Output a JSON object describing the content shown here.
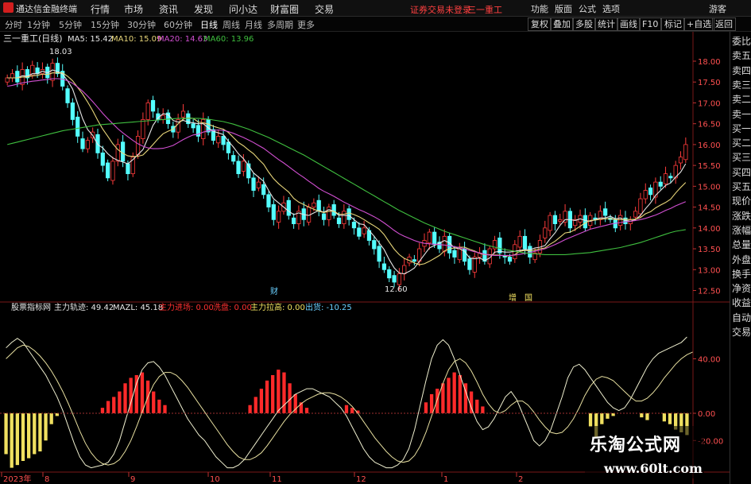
{
  "app": {
    "name": "通达信金融终端",
    "menus": [
      "行情",
      "市场",
      "资讯",
      "发现",
      "问小达",
      "财富圈",
      "交易"
    ],
    "login_notice": "证券交易未登录",
    "stock_short": "三一重工",
    "right_menus": [
      "功能",
      "版面",
      "公式",
      "选项"
    ],
    "guest": "游客"
  },
  "periods": [
    "分时",
    "1分钟",
    "5分钟",
    "15分钟",
    "30分钟",
    "60分钟",
    "日线",
    "周线",
    "月线",
    "多周期",
    "更多"
  ],
  "toolbar_right": [
    "复权",
    "叠加",
    "多股",
    "统计",
    "画线",
    "F10",
    "标记",
    "+自选",
    "返回"
  ],
  "side_panel": [
    "委比",
    "卖五",
    "卖四",
    "卖三",
    "卖二",
    "卖一",
    "买一",
    "买二",
    "买三",
    "买四",
    "买五",
    "现价",
    "涨跌",
    "涨幅",
    "总量",
    "外盘",
    "换手",
    "净资",
    "收益",
    "自动",
    "交易"
  ],
  "main_legend": {
    "title": "三一重工(日线)",
    "items": [
      {
        "label": "MA5: 15.42",
        "color": "#e6e6e6"
      },
      {
        "label": "MA10: 15.09",
        "color": "#e8d67a"
      },
      {
        "label": "MA20: 14.63",
        "color": "#d24fd2"
      },
      {
        "label": "MA60: 13.96",
        "color": "#3fbf3f"
      }
    ]
  },
  "sub_legend": {
    "name": "股票指标网",
    "items": [
      {
        "label": "主力轨迹: 49.42",
        "color": "#e6e6e6"
      },
      {
        "label": "MAZL: 45.18",
        "color": "#e6e6e6"
      },
      {
        "label": "主力进场: 0.00",
        "color": "#ff3030"
      },
      {
        "label": "洗盘: 0.00",
        "color": "#ff3030"
      },
      {
        "label": "主力拉高: 0.00",
        "color": "#f0e060"
      },
      {
        "label": "出货: -10.25",
        "color": "#6ad0ff"
      }
    ]
  },
  "annotations": {
    "high": "18.03",
    "low": "12.60",
    "marker1": "财",
    "marker2": "增",
    "marker3": "国"
  },
  "x_labels": [
    "2023年",
    "8",
    "9",
    "10",
    "11",
    "12",
    "1",
    "2"
  ],
  "colors": {
    "up": "#ff3b3b",
    "down": "#54ffff",
    "ma5": "#e6e6e6",
    "ma10": "#e8d67a",
    "ma20": "#d24fd2",
    "ma60": "#3fbf3f"
  },
  "watermark": {
    "line1": "乐淘公式网",
    "line2": "www.60lt.com"
  },
  "chart_data": [
    {
      "type": "candlestick",
      "y_ticks": [
        18.0,
        17.5,
        17.0,
        16.5,
        16.0,
        15.5,
        15.0,
        14.5,
        14.0,
        13.5,
        13.0,
        12.5
      ],
      "ylim": [
        12.3,
        18.4
      ],
      "close": [
        17.6,
        17.7,
        17.5,
        17.8,
        17.6,
        17.9,
        17.7,
        17.8,
        17.6,
        17.95,
        17.7,
        17.4,
        17.0,
        16.6,
        16.2,
        15.9,
        16.1,
        16.3,
        15.8,
        15.5,
        15.2,
        15.6,
        16.0,
        15.6,
        15.3,
        15.7,
        16.2,
        16.6,
        17.0,
        16.8,
        16.6,
        16.7,
        16.5,
        16.3,
        16.6,
        16.8,
        16.5,
        16.4,
        16.2,
        16.6,
        16.3,
        16.1,
        16.2,
        16.0,
        15.8,
        15.6,
        15.3,
        15.6,
        15.2,
        14.9,
        15.1,
        14.8,
        14.5,
        14.2,
        14.4,
        14.6,
        14.3,
        14.1,
        14.4,
        14.2,
        14.5,
        14.6,
        14.4,
        14.2,
        14.5,
        14.3,
        14.1,
        14.4,
        14.2,
        14.0,
        13.8,
        14.0,
        13.7,
        13.5,
        13.2,
        13.0,
        12.8,
        12.7,
        12.9,
        13.1,
        13.3,
        13.2,
        13.5,
        13.7,
        13.9,
        13.6,
        13.5,
        13.8,
        13.4,
        13.3,
        13.5,
        13.2,
        13.0,
        13.3,
        13.4,
        13.2,
        13.5,
        13.7,
        13.4,
        13.3,
        13.2,
        13.6,
        13.8,
        13.5,
        13.3,
        13.4,
        13.7,
        14.0,
        14.3,
        14.1,
        14.2,
        14.4,
        14.0,
        14.2,
        14.3,
        14.0,
        14.3,
        14.2,
        14.4,
        14.3,
        14.2,
        14.0,
        14.3,
        14.1,
        14.2,
        14.4,
        14.7,
        14.9,
        14.8,
        15.1,
        15.0,
        15.3,
        15.2,
        15.5,
        15.7,
        16.0
      ],
      "ma5": [
        17.6,
        17.6,
        17.6,
        17.65,
        17.64,
        17.7,
        17.7,
        17.76,
        17.72,
        17.79,
        17.75,
        17.69,
        17.53,
        17.33,
        16.98,
        16.62,
        16.36,
        16.22,
        16.0,
        15.92,
        15.78,
        15.68,
        15.62,
        15.58,
        15.54,
        15.64,
        15.76,
        15.88,
        16.16,
        16.46,
        16.64,
        16.74,
        16.72,
        16.58,
        16.54,
        16.58,
        16.54,
        16.52,
        16.5,
        16.5,
        16.4,
        16.32,
        16.28,
        16.24,
        16.08,
        15.94,
        15.78,
        15.66,
        15.5,
        15.32,
        15.22,
        15.12,
        14.9,
        14.7,
        14.6,
        14.5,
        14.4,
        14.32,
        14.36,
        14.32,
        14.3,
        14.36,
        14.42,
        14.38,
        14.44,
        14.4,
        14.3,
        14.3,
        14.3,
        14.2,
        14.1,
        14.08,
        13.94,
        13.8,
        13.64,
        13.48,
        13.24,
        13.04,
        12.92,
        12.9,
        12.96,
        13.04,
        13.2,
        13.36,
        13.52,
        13.58,
        13.64,
        13.7,
        13.64,
        13.52,
        13.5,
        13.44,
        13.28,
        13.26,
        13.28,
        13.22,
        13.28,
        13.42,
        13.44,
        13.42,
        13.42,
        13.44,
        13.46,
        13.48,
        13.48,
        13.52,
        13.54,
        13.58,
        13.74,
        13.88,
        14.06,
        14.2,
        14.2,
        14.18,
        14.22,
        14.18,
        14.16,
        14.2,
        14.24,
        14.24,
        14.28,
        14.22,
        14.24,
        14.18,
        14.16,
        14.2,
        14.3,
        14.46,
        14.6,
        14.78,
        14.9,
        15.02,
        15.08,
        15.22,
        15.34,
        15.54
      ],
      "ma10": [
        17.6,
        17.6,
        17.6,
        17.62,
        17.62,
        17.65,
        17.66,
        17.69,
        17.68,
        17.72,
        17.72,
        17.72,
        17.64,
        17.53,
        17.37,
        17.21,
        17.02,
        16.81,
        16.58,
        16.37,
        16.2,
        16.02,
        15.88,
        15.79,
        15.73,
        15.71,
        15.72,
        15.75,
        15.87,
        16.0,
        16.14,
        16.26,
        16.32,
        16.37,
        16.5,
        16.61,
        16.64,
        16.63,
        16.54,
        16.52,
        16.49,
        16.44,
        16.4,
        16.37,
        16.29,
        16.17,
        16.05,
        15.97,
        15.87,
        15.78,
        15.65,
        15.53,
        15.34,
        15.18,
        15.06,
        14.96,
        14.86,
        14.71,
        14.62,
        14.56,
        14.5,
        14.45,
        14.4,
        14.37,
        14.4,
        14.4,
        14.33,
        14.33,
        14.36,
        14.32,
        14.27,
        14.2,
        14.12,
        14.05,
        13.97,
        13.84,
        13.66,
        13.49,
        13.36,
        13.27,
        13.22,
        13.16,
        13.12,
        13.14,
        13.2,
        13.27,
        13.34,
        13.45,
        13.5,
        13.52,
        13.54,
        13.54,
        13.49,
        13.45,
        13.39,
        13.36,
        13.36,
        13.35,
        13.35,
        13.33,
        13.33,
        13.36,
        13.44,
        13.46,
        13.45,
        13.47,
        13.5,
        13.52,
        13.61,
        13.68,
        13.78,
        13.88,
        13.9,
        13.96,
        14.04,
        14.12,
        14.18,
        14.19,
        14.21,
        14.22,
        14.23,
        14.2,
        14.2,
        14.21,
        14.2,
        14.21,
        14.25,
        14.34,
        14.39,
        14.48,
        14.55,
        14.61,
        14.69,
        14.84,
        14.97,
        15.09
      ],
      "ma20": [
        17.4,
        17.42,
        17.45,
        17.48,
        17.5,
        17.52,
        17.53,
        17.55,
        17.56,
        17.58,
        17.58,
        17.57,
        17.53,
        17.47,
        17.38,
        17.28,
        17.16,
        17.03,
        16.89,
        16.75,
        16.62,
        16.5,
        16.38,
        16.28,
        16.19,
        16.1,
        16.02,
        15.96,
        15.92,
        15.9,
        15.9,
        15.91,
        15.94,
        15.98,
        16.05,
        16.12,
        16.18,
        16.23,
        16.25,
        16.3,
        16.33,
        16.34,
        16.35,
        16.34,
        16.31,
        16.27,
        16.22,
        16.17,
        16.11,
        16.05,
        15.98,
        15.91,
        15.82,
        15.73,
        15.64,
        15.56,
        15.47,
        15.38,
        15.29,
        15.21,
        15.12,
        15.04,
        14.95,
        14.88,
        14.82,
        14.76,
        14.69,
        14.62,
        14.56,
        14.5,
        14.44,
        14.39,
        14.33,
        14.27,
        14.2,
        14.12,
        14.03,
        13.94,
        13.86,
        13.8,
        13.75,
        13.7,
        13.66,
        13.63,
        13.62,
        13.61,
        13.6,
        13.59,
        13.57,
        13.55,
        13.53,
        13.5,
        13.46,
        13.43,
        13.4,
        13.37,
        13.35,
        13.34,
        13.34,
        13.34,
        13.34,
        13.35,
        13.37,
        13.39,
        13.41,
        13.44,
        13.47,
        13.5,
        13.55,
        13.6,
        13.66,
        13.72,
        13.77,
        13.82,
        13.87,
        13.92,
        13.97,
        14.0,
        14.03,
        14.06,
        14.09,
        14.11,
        14.13,
        14.15,
        14.16,
        14.18,
        14.2,
        14.23,
        14.27,
        14.31,
        14.36,
        14.42,
        14.47,
        14.53,
        14.58,
        14.63
      ],
      "ma60": [
        16.0,
        16.03,
        16.06,
        16.09,
        16.12,
        16.15,
        16.18,
        16.21,
        16.24,
        16.27,
        16.3,
        16.33,
        16.35,
        16.37,
        16.39,
        16.41,
        16.43,
        16.45,
        16.47,
        16.48,
        16.49,
        16.5,
        16.51,
        16.52,
        16.53,
        16.54,
        16.55,
        16.56,
        16.57,
        16.58,
        16.59,
        16.6,
        16.61,
        16.62,
        16.63,
        16.63,
        16.63,
        16.63,
        16.63,
        16.62,
        16.61,
        16.59,
        16.57,
        16.55,
        16.52,
        16.49,
        16.45,
        16.41,
        16.37,
        16.32,
        16.27,
        16.22,
        16.17,
        16.11,
        16.05,
        15.99,
        15.93,
        15.87,
        15.81,
        15.75,
        15.68,
        15.61,
        15.54,
        15.47,
        15.4,
        15.33,
        15.26,
        15.19,
        15.12,
        15.05,
        14.98,
        14.91,
        14.84,
        14.77,
        14.7,
        14.63,
        14.56,
        14.49,
        14.42,
        14.36,
        14.3,
        14.24,
        14.18,
        14.12,
        14.07,
        14.02,
        13.97,
        13.92,
        13.88,
        13.84,
        13.8,
        13.76,
        13.72,
        13.68,
        13.64,
        13.6,
        13.57,
        13.54,
        13.51,
        13.48,
        13.46,
        13.44,
        13.42,
        13.4,
        13.39,
        13.38,
        13.37,
        13.36,
        13.36,
        13.36,
        13.36,
        13.36,
        13.37,
        13.38,
        13.39,
        13.4,
        13.41,
        13.43,
        13.45,
        13.47,
        13.49,
        13.51,
        13.53,
        13.56,
        13.59,
        13.62,
        13.65,
        13.69,
        13.73,
        13.77,
        13.81,
        13.85,
        13.89,
        13.92,
        13.94,
        13.96
      ]
    },
    {
      "type": "bar-line",
      "y_ticks": [
        40.0,
        0.0,
        -20.0
      ],
      "ylim": [
        -42,
        70
      ],
      "main_line": [
        48,
        52,
        55,
        52,
        46,
        40,
        34,
        28,
        20,
        12,
        2,
        -10,
        -22,
        -32,
        -38,
        -40,
        -39,
        -38,
        -36,
        -30,
        -20,
        -6,
        8,
        22,
        32,
        37,
        38,
        34,
        28,
        20,
        12,
        4,
        -4,
        -10,
        -16,
        -20,
        -26,
        -32,
        -36,
        -40,
        -40,
        -38,
        -34,
        -28,
        -22,
        -16,
        -10,
        -4,
        2,
        6,
        10,
        14,
        16,
        18,
        18,
        16,
        14,
        12,
        8,
        4,
        -2,
        -10,
        -18,
        -26,
        -32,
        -36,
        -38,
        -40,
        -40,
        -38,
        -34,
        -26,
        -12,
        6,
        24,
        40,
        50,
        54,
        50,
        40,
        28,
        16,
        4,
        -6,
        -12,
        -10,
        -4,
        4,
        12,
        16,
        10,
        0,
        -10,
        -20,
        -24,
        -20,
        -12,
        0,
        12,
        26,
        34,
        36,
        32,
        26,
        20,
        14,
        8,
        4,
        2,
        4,
        10,
        18,
        26,
        34,
        40,
        44,
        46,
        48,
        50,
        52,
        56
      ],
      "signal_line": [
        40,
        44,
        48,
        50,
        49,
        46,
        42,
        37,
        31,
        24,
        16,
        7,
        -3,
        -13,
        -22,
        -29,
        -34,
        -37,
        -38,
        -37,
        -34,
        -28,
        -20,
        -10,
        1,
        12,
        21,
        27,
        30,
        30,
        28,
        24,
        19,
        13,
        7,
        1,
        -5,
        -11,
        -17,
        -23,
        -28,
        -32,
        -34,
        -34,
        -32,
        -29,
        -24,
        -18,
        -12,
        -6,
        -1,
        3,
        7,
        10,
        12,
        14,
        15,
        15,
        14,
        12,
        9,
        5,
        0,
        -6,
        -12,
        -18,
        -23,
        -28,
        -32,
        -35,
        -36,
        -35,
        -31,
        -24,
        -14,
        -2,
        10,
        22,
        32,
        38,
        40,
        37,
        31,
        23,
        14,
        7,
        2,
        0,
        2,
        6,
        9,
        9,
        6,
        1,
        -5,
        -10,
        -14,
        -15,
        -14,
        -10,
        -4,
        4,
        13,
        20,
        25,
        27,
        26,
        24,
        20,
        16,
        12,
        9,
        9,
        11,
        15,
        20,
        26,
        31,
        36,
        40,
        43,
        45
      ],
      "bars": [
        -30,
        -40,
        -38,
        -35,
        -33,
        -30,
        -28,
        -20,
        -8,
        -2,
        0,
        0,
        0,
        0,
        0,
        0,
        0,
        4,
        9,
        12,
        16,
        22,
        26,
        28,
        30,
        24,
        16,
        10,
        6,
        0,
        0,
        0,
        0,
        0,
        0,
        0,
        0,
        0,
        0,
        0,
        0,
        0,
        0,
        6,
        12,
        18,
        24,
        28,
        32,
        30,
        22,
        14,
        8,
        4,
        0,
        0,
        0,
        0,
        0,
        0,
        6,
        4,
        2,
        0,
        0,
        0,
        0,
        0,
        0,
        0,
        0,
        0,
        0,
        0,
        8,
        14,
        18,
        22,
        26,
        30,
        28,
        22,
        16,
        10,
        5,
        0,
        0,
        0,
        0,
        0,
        0,
        0,
        0,
        0,
        0,
        0,
        0,
        0,
        0,
        0,
        0,
        0,
        0,
        -10,
        -18,
        -8,
        -4,
        -2,
        0,
        0,
        0,
        0,
        -3,
        -5,
        0,
        0,
        -6,
        -8,
        -12,
        -14,
        -16
      ]
    }
  ]
}
